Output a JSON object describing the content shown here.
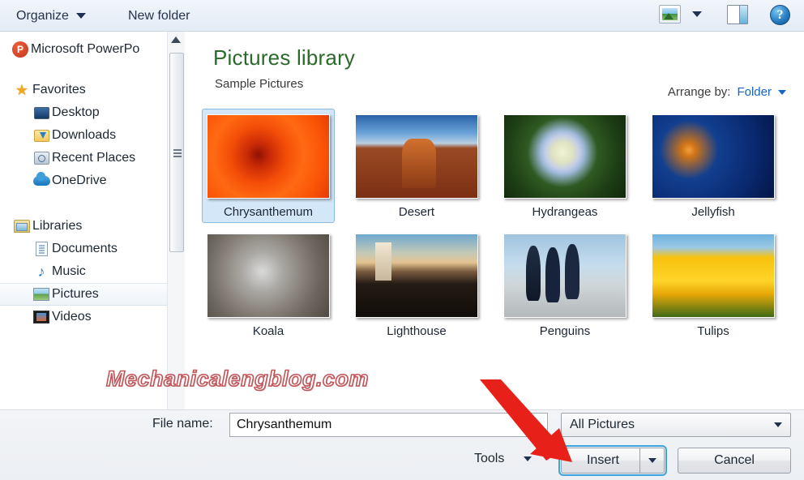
{
  "toolbar": {
    "organize_label": "Organize",
    "new_folder_label": "New folder",
    "views_icon": "views-icon",
    "preview_pane_icon": "preview-pane-icon",
    "help_icon": "help-icon",
    "help_glyph": "?"
  },
  "sidebar": {
    "app_entry": {
      "label": "Microsoft PowerPo",
      "icon": "powerpoint-icon"
    },
    "groups": [
      {
        "header": {
          "label": "Favorites",
          "icon": "star-icon"
        },
        "items": [
          {
            "label": "Desktop",
            "icon": "desktop-icon"
          },
          {
            "label": "Downloads",
            "icon": "downloads-icon"
          },
          {
            "label": "Recent Places",
            "icon": "recent-places-icon"
          },
          {
            "label": "OneDrive",
            "icon": "onedrive-cloud-icon"
          }
        ]
      },
      {
        "header": {
          "label": "Libraries",
          "icon": "libraries-icon"
        },
        "items": [
          {
            "label": "Documents",
            "icon": "documents-icon"
          },
          {
            "label": "Music",
            "icon": "music-note-icon"
          },
          {
            "label": "Pictures",
            "icon": "pictures-icon",
            "selected": true
          },
          {
            "label": "Videos",
            "icon": "videos-icon"
          }
        ]
      }
    ]
  },
  "content": {
    "library_title": "Pictures library",
    "library_subtitle": "Sample Pictures",
    "arrange_label": "Arrange by:",
    "arrange_value": "Folder",
    "files": [
      {
        "name": "Chrysanthemum",
        "art": "t-chrys",
        "selected": true
      },
      {
        "name": "Desert",
        "art": "t-desert",
        "selected": false
      },
      {
        "name": "Hydrangeas",
        "art": "t-hydr",
        "selected": false
      },
      {
        "name": "Jellyfish",
        "art": "t-jelly",
        "selected": false
      },
      {
        "name": "Koala",
        "art": "t-koala",
        "selected": false
      },
      {
        "name": "Lighthouse",
        "art": "t-light",
        "selected": false
      },
      {
        "name": "Penguins",
        "art": "t-peng",
        "selected": false
      },
      {
        "name": "Tulips",
        "art": "t-tulip",
        "selected": false
      }
    ]
  },
  "footer": {
    "file_name_label": "File name:",
    "file_name_value": "Chrysanthemum",
    "file_name_placeholder": "File name",
    "file_type_value": "All Pictures",
    "tools_label": "Tools",
    "insert_label": "Insert",
    "cancel_label": "Cancel"
  },
  "annotations": {
    "watermark_text": "Mechanicalengblog.com",
    "arrow_color": "#e8201a",
    "arrow_target": "insert-button"
  },
  "colors": {
    "library_title_green": "#2b6a2b",
    "link_blue": "#1664c8",
    "selection_blue": "#d4e7f8",
    "focus_ring_blue": "#3aa3e0"
  }
}
